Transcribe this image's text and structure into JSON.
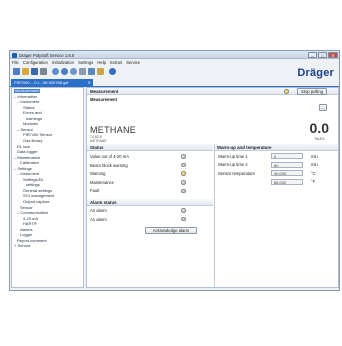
{
  "window": {
    "title": "Dräger PolySoft Service 1.6.0",
    "controls": {
      "minimize": "–",
      "maximize": "□",
      "close": "✕"
    }
  },
  "menu": [
    "File",
    "Configuration",
    "Initialization",
    "Settings",
    "Help",
    "Extras",
    "Service"
  ],
  "toolbar": {
    "icons": [
      "new-icon",
      "open-icon",
      "save-icon",
      "print-icon",
      "connect-icon",
      "config-icon",
      "settings-icon",
      "device-icon",
      "transfer-icon",
      "key-icon",
      "help-icon"
    ],
    "brand": "Dräger"
  },
  "doc_tab": {
    "label": "PIR7000 – C:\\...\\W-920788.gzf",
    "close": "✕"
  },
  "tree": [
    {
      "label": "Measurement",
      "indent": 0,
      "selected": true
    },
    {
      "label": "– Information",
      "indent": 0
    },
    {
      "label": "– Instrument",
      "indent": 1
    },
    {
      "label": "Status",
      "indent": 3
    },
    {
      "label": "Errors and",
      "indent": 3
    },
    {
      "label": "warnings",
      "indent": 4
    },
    {
      "label": "Modules",
      "indent": 3
    },
    {
      "label": "– Sensor",
      "indent": 1
    },
    {
      "label": "PIR7x00 Sensor",
      "indent": 3
    },
    {
      "label": "Gas library",
      "indent": 3
    },
    {
      "label": "DL lock",
      "indent": 1
    },
    {
      "label": "Data logger",
      "indent": 1
    },
    {
      "label": "– Maintenance",
      "indent": 0
    },
    {
      "label": "Calibration",
      "indent": 2
    },
    {
      "label": "– Settings",
      "indent": 0
    },
    {
      "label": "– Instrument",
      "indent": 1
    },
    {
      "label": "Settings/DL",
      "indent": 3
    },
    {
      "label": "settings",
      "indent": 4
    },
    {
      "label": "General settings",
      "indent": 3
    },
    {
      "label": "SGI management",
      "indent": 3
    },
    {
      "label": "Output capture",
      "indent": 3
    },
    {
      "label": "Sensor",
      "indent": 2
    },
    {
      "label": "– Communication",
      "indent": 1
    },
    {
      "label": "4-20 mA",
      "indent": 3
    },
    {
      "label": "HART®",
      "indent": 3
    },
    {
      "label": "Alarms",
      "indent": 2
    },
    {
      "label": "Logger",
      "indent": 2
    },
    {
      "label": "Report comment",
      "indent": 1
    },
    {
      "label": "+ Service",
      "indent": 0
    }
  ],
  "measurement": {
    "header": "Measurement",
    "stop_button": "Stop polling",
    "sub_header": "Measurement",
    "small_button": "...",
    "gas_name": "METHANE",
    "gas_sub1": "74-82-8",
    "gas_sub2": "METHANE",
    "value": "0.0",
    "unit": "%LEL"
  },
  "status": {
    "header": "Status",
    "rows": [
      {
        "label": "Value out of 4-20 mA",
        "state": "gray"
      },
      {
        "label": "Beam block warning",
        "state": "gray"
      },
      {
        "label": "Warning",
        "state": "yellow"
      },
      {
        "label": "Maintenance",
        "state": "gray"
      },
      {
        "label": "Fault",
        "state": "gray"
      }
    ]
  },
  "warmup": {
    "header": "Warm-up and temperature",
    "rows": [
      {
        "label": "Warm-up time 1",
        "value": "0",
        "unit": "min"
      },
      {
        "label": "Warm-up time 2",
        "value": "60",
        "unit": "min"
      },
      {
        "label": "Sensor temperature",
        "value": "30.000",
        "unit": "°C"
      },
      {
        "label": "",
        "value": "86.000",
        "unit": "°F"
      }
    ]
  },
  "alarm": {
    "header": "Alarm status",
    "rows": [
      {
        "label": "A2 alarm",
        "state": "gray"
      },
      {
        "label": "A1 alarm",
        "state": "gray"
      }
    ],
    "ack_button": "Acknowledge alarm"
  },
  "colors": {
    "accent": "#2b6fc8",
    "brand": "#1b3f85",
    "warning": "#e0b400"
  }
}
